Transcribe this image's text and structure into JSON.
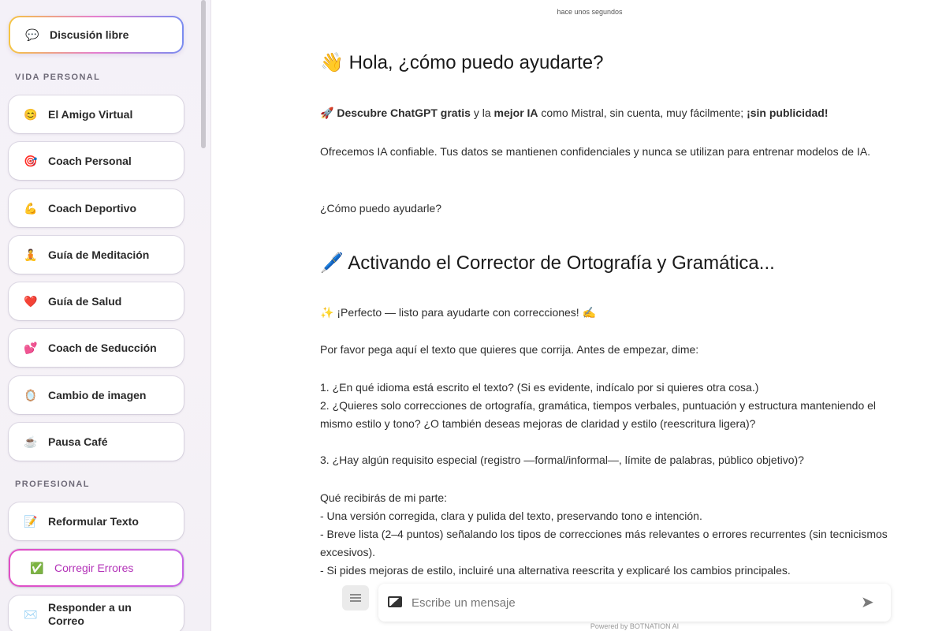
{
  "sidebar": {
    "top_item": {
      "icon": "💬",
      "label": "Discusión libre"
    },
    "section_personal": "VIDA PERSONAL",
    "personal_items": [
      {
        "icon": "😊",
        "label": "El Amigo Virtual"
      },
      {
        "icon": "🎯",
        "label": "Coach Personal"
      },
      {
        "icon": "💪",
        "label": "Coach Deportivo"
      },
      {
        "icon": "🧘",
        "label": "Guía de Meditación"
      },
      {
        "icon": "❤️",
        "label": "Guía de Salud"
      },
      {
        "icon": "💕",
        "label": "Coach de Seducción"
      },
      {
        "icon": "🪞",
        "label": "Cambio de imagen"
      },
      {
        "icon": "☕",
        "label": "Pausa Café"
      }
    ],
    "section_professional": "PROFESIONAL",
    "professional_items": [
      {
        "icon": "📝",
        "label": "Reformular Texto"
      },
      {
        "icon": "✅",
        "label": "Corregir Errores",
        "active": true
      },
      {
        "icon": "✉️",
        "label": "Responder a un Correo"
      }
    ]
  },
  "chat": {
    "timestamp": "hace unos segundos",
    "greeting": {
      "emoji": "👋",
      "text": "Hola, ¿cómo puedo ayudarte?"
    },
    "intro": {
      "emoji": "🚀",
      "bold1": "Descubre ChatGPT gratis",
      "mid1": " y la ",
      "bold2": "mejor IA",
      "mid2": " como Mistral, sin cuenta, muy fácilmente; ",
      "bold3": "¡sin publicidad!"
    },
    "trust": "Ofrecemos IA confiable. Tus datos se mantienen confidenciales y nunca se utilizan para entrenar modelos de IA.",
    "ask": "¿Cómo puedo ayudarle?",
    "heading2": {
      "emoji": "🖊️",
      "text": "Activando el Corrector de Ortografía y Gramática..."
    },
    "perfect": "✨ ¡Perfecto — listo para ayudarte con correcciones! ✍️",
    "please": "Por favor pega aquí el texto que quieres que corrija. Antes de empezar, dime:",
    "q1": "1. ¿En qué idioma está escrito el texto? (Si es evidente, indícalo por si quieres otra cosa.)",
    "q2": "2. ¿Quieres solo correcciones de ortografía, gramática, tiempos verbales, puntuación y estructura manteniendo el mismo estilo y tono? ¿O también deseas mejoras de claridad y estilo (reescritura ligera)?",
    "q3": "3. ¿Hay algún requisito especial (registro —formal/informal—, límite de palabras, público objetivo)?",
    "receive_title": "Qué recibirás de mi parte:",
    "r1": "- Una versión corregida, clara y pulida del texto, preservando tono e intención.",
    "r2": "- Breve lista (2–4 puntos) señalando los tipos de correcciones más relevantes o errores recurrentes (sin tecnicismos excesivos).",
    "r3": "- Si pides mejoras de estilo, incluiré una alternativa reescrita y explicaré los cambios principales."
  },
  "composer": {
    "placeholder": "Escribe un mensaje",
    "send_icon": "➤",
    "powered": "Powered by BOTNATION AI"
  }
}
